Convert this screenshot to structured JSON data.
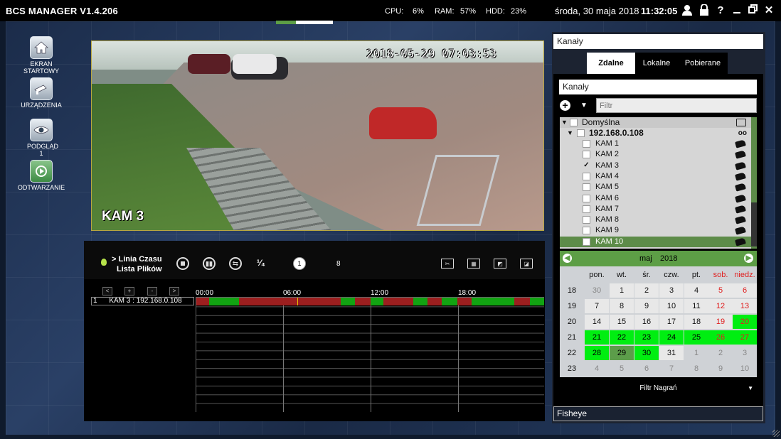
{
  "app": {
    "title": "BCS MANAGER V1.4.206"
  },
  "stats": {
    "cpu_label": "CPU:",
    "cpu_value": "6%",
    "ram_label": "RAM:",
    "ram_value": "57%",
    "hdd_label": "HDD:",
    "hdd_value": "23%"
  },
  "datetime": {
    "date": "środa, 30 maja 2018",
    "time": "11:32:05"
  },
  "top_icons": [
    "user-icon",
    "lock-icon",
    "help-icon",
    "minimize-icon",
    "restore-icon",
    "close-icon"
  ],
  "nav": [
    {
      "label": "EKRAN STARTOWY",
      "icon": "home-icon"
    },
    {
      "label": "URZĄDZENIA",
      "icon": "camera-icon"
    },
    {
      "label": "PODGLĄD 1",
      "icon": "eye-icon"
    },
    {
      "label": "ODTWARZANIE",
      "icon": "playback-icon"
    }
  ],
  "video": {
    "timestamp": "2018-05-29 07:03:53",
    "camera": "KAM 3"
  },
  "playback": {
    "mode_timeline": "> Linia Czasu",
    "mode_filelist": "Lista Plików",
    "speed_label": "¹⁄₄",
    "speed_value": "1",
    "speed_max": "8",
    "speed_fill": 0.35,
    "nav_buttons": [
      "<",
      "+",
      "-",
      ">"
    ],
    "ticks": [
      "00:00",
      "06:00",
      "12:00",
      "18:00"
    ],
    "row_index": "1",
    "row_label": "KAM 3 : 192.168.0.108"
  },
  "right_panel": {
    "header_field": "Kanały",
    "tabs": [
      "Zdalne",
      "Lokalne",
      "Pobierane"
    ],
    "active_tab": "Zdalne",
    "channels_field": "Kanały",
    "filter_placeholder": "Filtr",
    "tree": {
      "group": "Domyślna",
      "device": "192.168.0.108",
      "cameras": [
        {
          "name": "KAM 1",
          "checked": false
        },
        {
          "name": "KAM 2",
          "checked": false
        },
        {
          "name": "KAM 3",
          "checked": true
        },
        {
          "name": "KAM 4",
          "checked": false
        },
        {
          "name": "KAM 5",
          "checked": false
        },
        {
          "name": "KAM 6",
          "checked": false
        },
        {
          "name": "KAM 7",
          "checked": false
        },
        {
          "name": "KAM 8",
          "checked": false
        },
        {
          "name": "KAM 9",
          "checked": false
        },
        {
          "name": "KAM 10",
          "checked": false,
          "selected": true
        }
      ]
    },
    "calendar": {
      "month": "maj",
      "year": "2018",
      "weekdays": [
        "pon.",
        "wt.",
        "śr.",
        "czw.",
        "pt.",
        "sob.",
        "niedz."
      ],
      "weeks": [
        {
          "week": "18",
          "days": [
            "30",
            "1",
            "2",
            "3",
            "4",
            "5",
            "6"
          ]
        },
        {
          "week": "19",
          "days": [
            "7",
            "8",
            "9",
            "10",
            "11",
            "12",
            "13"
          ]
        },
        {
          "week": "20",
          "days": [
            "14",
            "15",
            "16",
            "17",
            "18",
            "19",
            "20"
          ]
        },
        {
          "week": "21",
          "days": [
            "21",
            "22",
            "23",
            "24",
            "25",
            "26",
            "27"
          ]
        },
        {
          "week": "22",
          "days": [
            "28",
            "29",
            "30",
            "31",
            "1",
            "2",
            "3"
          ]
        },
        {
          "week": "23",
          "days": [
            "4",
            "5",
            "6",
            "7",
            "8",
            "9",
            "10"
          ]
        }
      ],
      "recording_days": [
        "20",
        "21",
        "22",
        "23",
        "24",
        "25",
        "26",
        "27",
        "28",
        "29",
        "30"
      ],
      "selected_day": "29",
      "colors": {
        "recording": "#00ee11",
        "selected": "#5c9d4a",
        "weekend": "#e02020",
        "other_month": "#888888"
      }
    },
    "record_filter": "Filtr Nagrań",
    "fisheye": "Fisheye"
  },
  "colors": {
    "accent_green": "#5d9e46",
    "recording_green": "#12a312",
    "recording_red": "#9c1f1f"
  }
}
